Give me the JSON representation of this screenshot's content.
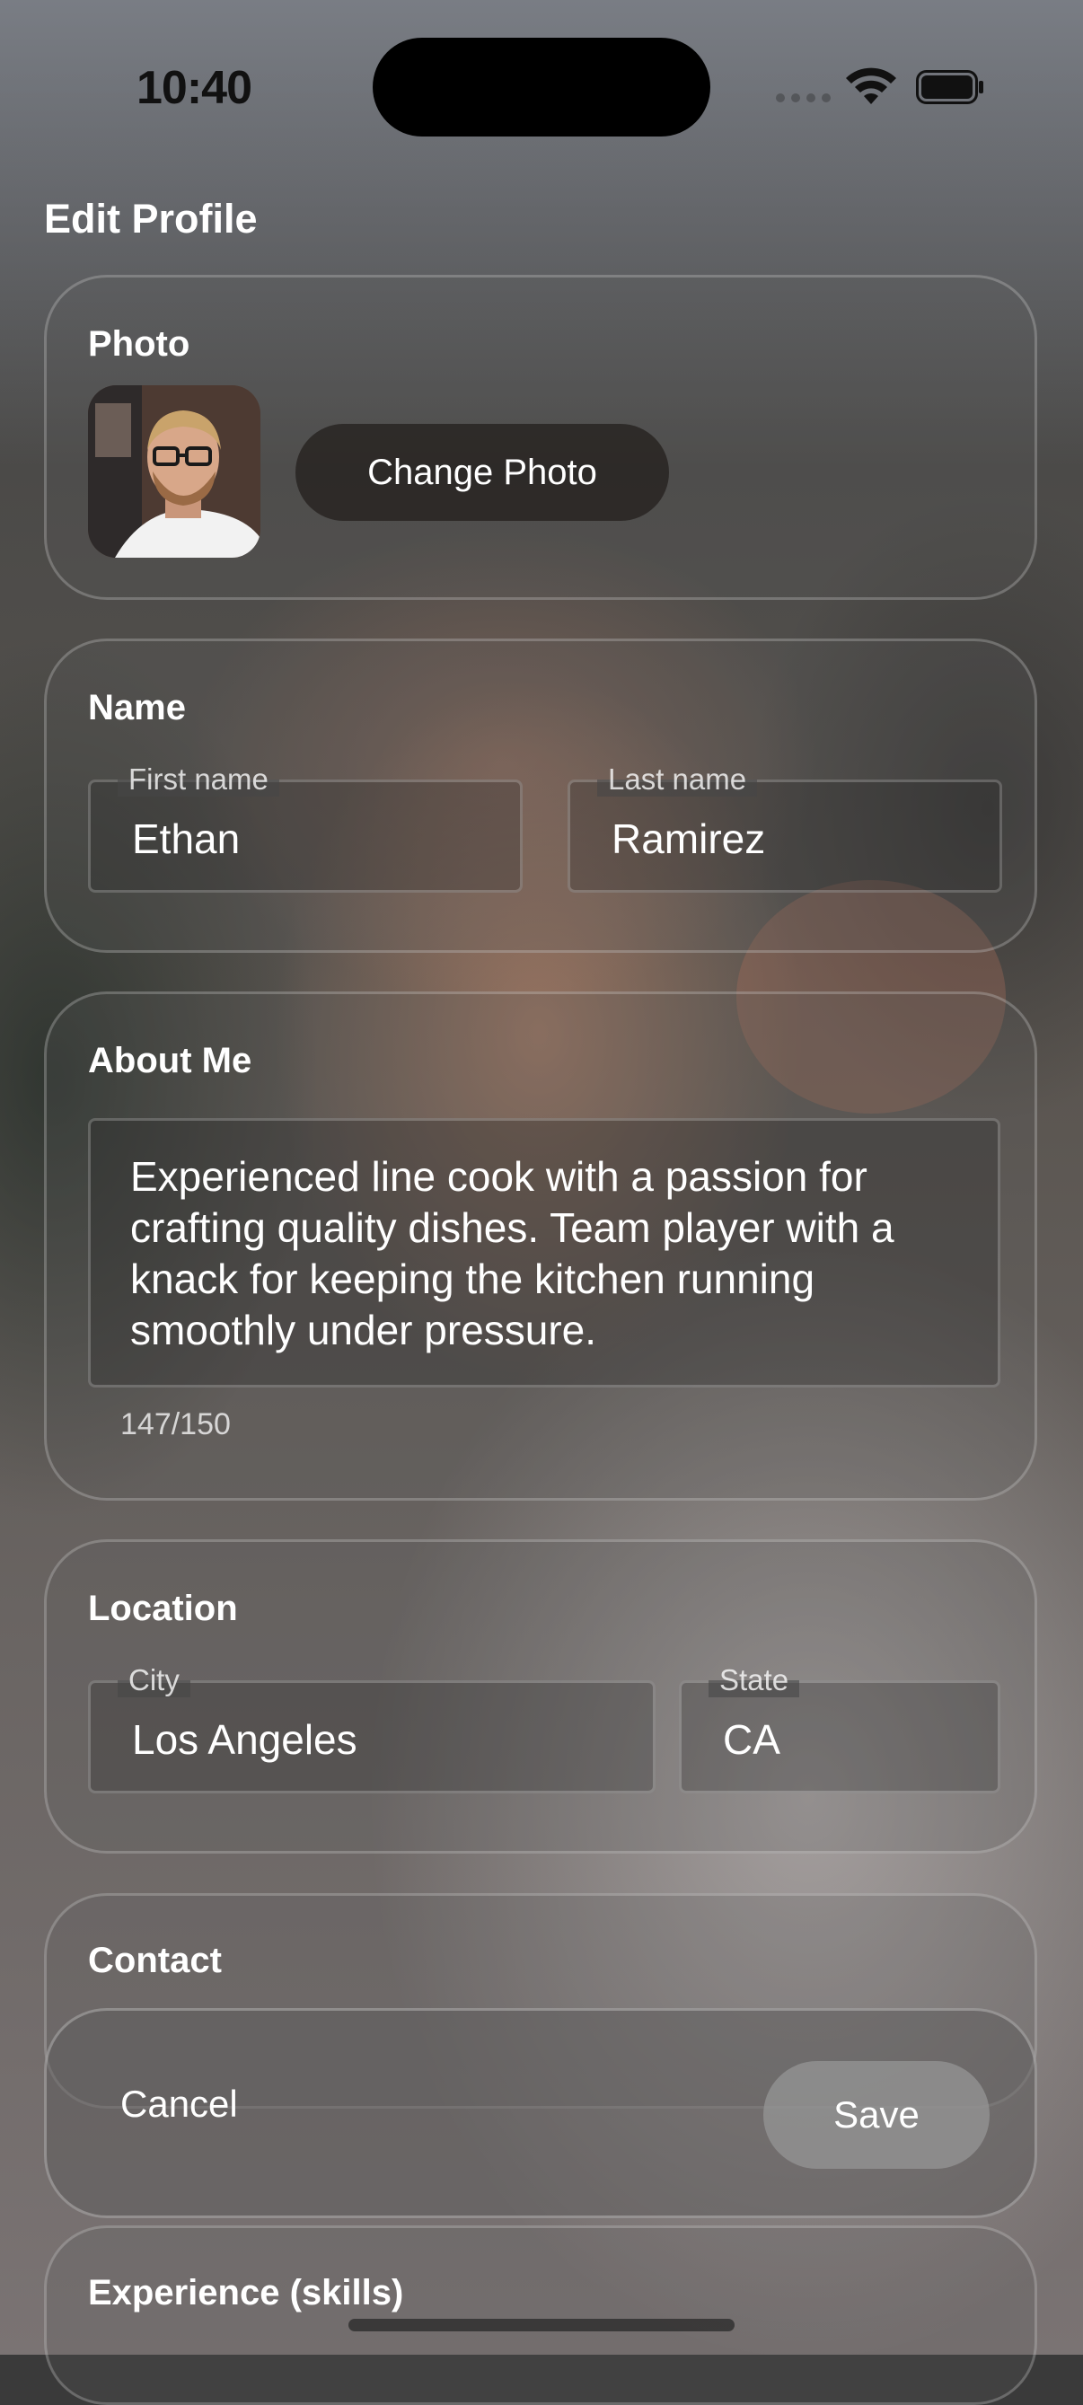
{
  "status_bar": {
    "time": "10:40"
  },
  "page": {
    "title": "Edit Profile"
  },
  "photo_card": {
    "title": "Photo",
    "change_photo_label": "Change Photo",
    "avatar_icon": "person-photo"
  },
  "name_card": {
    "title": "Name",
    "first_name": {
      "label": "First name",
      "value": "Ethan"
    },
    "last_name": {
      "label": "Last name",
      "value": "Ramirez"
    }
  },
  "about_card": {
    "title": "About Me",
    "text": "Experienced line cook with a passion for crafting quality dishes. Team player with a knack for keeping the kitchen running smoothly under pressure.",
    "counter": "147/150"
  },
  "location_card": {
    "title": "Location",
    "city": {
      "label": "City",
      "value": "Los Angeles"
    },
    "state": {
      "label": "State",
      "value": "CA"
    }
  },
  "contact_card": {
    "title": "Contact"
  },
  "experience_card": {
    "title": "Experience (skills)"
  },
  "actions": {
    "cancel_label": "Cancel",
    "save_label": "Save"
  }
}
